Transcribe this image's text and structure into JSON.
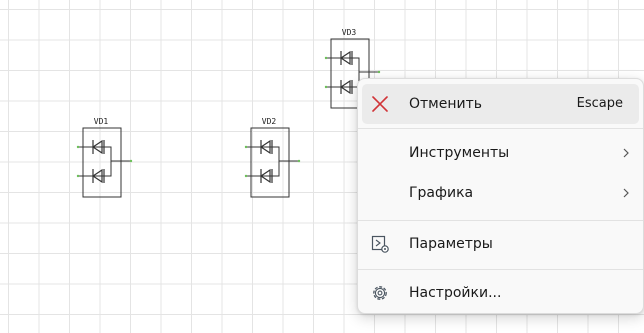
{
  "canvas": {
    "components": [
      {
        "id": "VD1",
        "label": "VD1"
      },
      {
        "id": "VD2",
        "label": "VD2"
      },
      {
        "id": "VD3",
        "label": "VD3"
      }
    ]
  },
  "context_menu": {
    "items": [
      {
        "label": "Отменить",
        "shortcut": "Escape",
        "icon": "close-icon",
        "has_submenu": false
      },
      {
        "label": "Инструменты",
        "icon": "",
        "has_submenu": true
      },
      {
        "label": "Графика",
        "icon": "",
        "has_submenu": true
      },
      {
        "label": "Параметры",
        "icon": "parameters-icon",
        "has_submenu": false
      },
      {
        "label": "Настройки...",
        "icon": "settings-gear-icon",
        "has_submenu": false
      }
    ]
  },
  "colors": {
    "grid_line": "#e4e4e4",
    "cancel_icon": "#d13438",
    "menu_background": "#f9f9f9",
    "highlight": "#ebebeb"
  }
}
